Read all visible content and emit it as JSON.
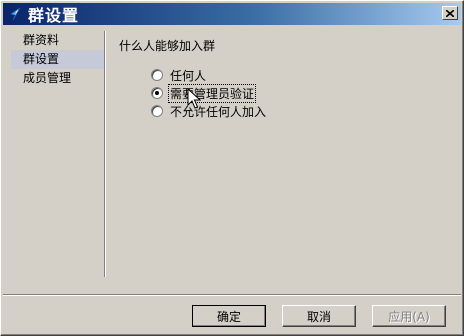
{
  "window": {
    "title": "群设置"
  },
  "sidebar": {
    "items": [
      {
        "label": "群资料",
        "selected": false
      },
      {
        "label": "群设置",
        "selected": true
      },
      {
        "label": "成员管理",
        "selected": false
      }
    ]
  },
  "content": {
    "question": "什么人能够加入群",
    "options": [
      {
        "label": "任何人",
        "checked": false
      },
      {
        "label": "需要管理员验证",
        "checked": true
      },
      {
        "label": "不允许任何人加入",
        "checked": false
      }
    ]
  },
  "buttons": {
    "ok": "确定",
    "cancel": "取消",
    "apply": "应用(A)"
  },
  "colors": {
    "titlebar_start": "#0a246a",
    "titlebar_end": "#a6caf0",
    "face": "#d4d0c8",
    "selected_item": "#c5c9d8"
  },
  "icons": {
    "app": "app-logo-icon",
    "close": "close-icon",
    "cursor": "mouse-pointer-icon"
  }
}
